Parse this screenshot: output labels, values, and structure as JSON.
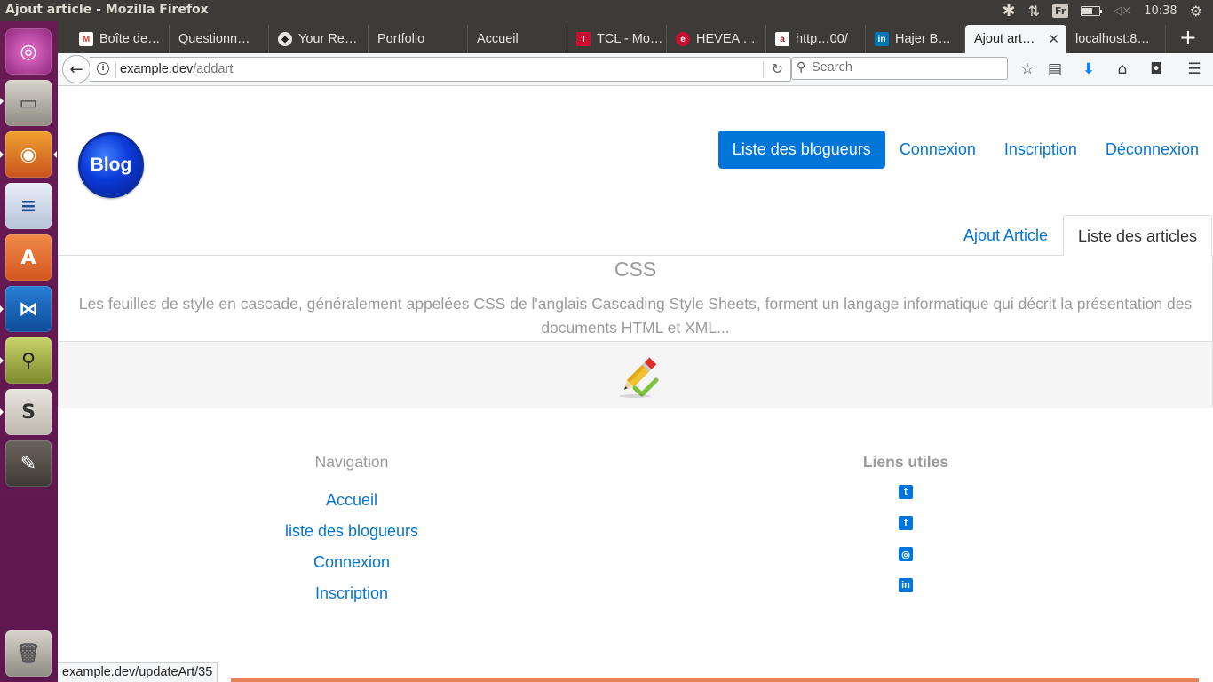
{
  "window": {
    "title": "Ajout article - Mozilla Firefox"
  },
  "system": {
    "keyboard": "Fr",
    "clock": "10:38",
    "battery_level": 0.6
  },
  "launcher": {
    "items": [
      {
        "name": "ubuntu-dash",
        "glyph": "◎"
      },
      {
        "name": "files",
        "glyph": "▭"
      },
      {
        "name": "firefox",
        "glyph": "◉"
      },
      {
        "name": "libreoffice-writer",
        "glyph": "≡"
      },
      {
        "name": "software-center",
        "glyph": "A"
      },
      {
        "name": "vscode",
        "glyph": "⋈"
      },
      {
        "name": "system-monitor",
        "glyph": "⚲"
      },
      {
        "name": "slack",
        "glyph": "S"
      },
      {
        "name": "gimp",
        "glyph": "✎"
      }
    ],
    "trash_glyph": "🗑"
  },
  "tabs": [
    {
      "label": "Boîte de…",
      "icon": "M",
      "icon_color": "#d44638"
    },
    {
      "label": "Questionn…",
      "icon": "",
      "icon_color": ""
    },
    {
      "label": "Your Re…",
      "icon": "◆",
      "icon_color": "#222222"
    },
    {
      "label": "Portfolio",
      "icon": "",
      "icon_color": ""
    },
    {
      "label": "Accueil",
      "icon": "",
      "icon_color": ""
    },
    {
      "label": "TCL - Mo…",
      "icon": "T",
      "icon_color": "#c8102e"
    },
    {
      "label": "HEVEA …",
      "icon": "e",
      "icon_color": "#c8102e"
    },
    {
      "label": "http…00/",
      "icon": "a",
      "icon_color": "#8b1a1a"
    },
    {
      "label": "Hajer B…",
      "icon": "in",
      "icon_color": "#0077b5"
    },
    {
      "label": "Ajout art…",
      "icon": "",
      "icon_color": "",
      "active": true
    },
    {
      "label": "localhost:8…",
      "icon": "",
      "icon_color": ""
    }
  ],
  "navbar": {
    "url_host": "example.dev",
    "url_path": "/addart",
    "search_placeholder": "Search"
  },
  "site": {
    "logo_text": "Blog",
    "nav": {
      "bloggers": "Liste des blogueurs",
      "login": "Connexion",
      "signup": "Inscription",
      "logout": "Déconnexion"
    },
    "tabs": {
      "add_article": "Ajout Article",
      "list_articles": "Liste des articles"
    },
    "article": {
      "title": "CSS",
      "excerpt": "Les feuilles de style en cascade, généralement appelées CSS de l'anglais Cascading Style Sheets, forment un langage informatique qui décrit la présentation des documents HTML et XML..."
    },
    "footer": {
      "nav_heading": "Navigation",
      "nav_links": [
        "Accueil",
        "liste des blogueurs",
        "Connexion",
        "Inscription"
      ],
      "useful_heading": "Liens utiles",
      "social": [
        {
          "name": "twitter",
          "glyph": "t"
        },
        {
          "name": "facebook",
          "glyph": "f"
        },
        {
          "name": "instagram",
          "glyph": "◎"
        },
        {
          "name": "linkedin",
          "glyph": "in"
        }
      ]
    }
  },
  "status": {
    "hover_url": "example.dev/updateArt/35"
  }
}
